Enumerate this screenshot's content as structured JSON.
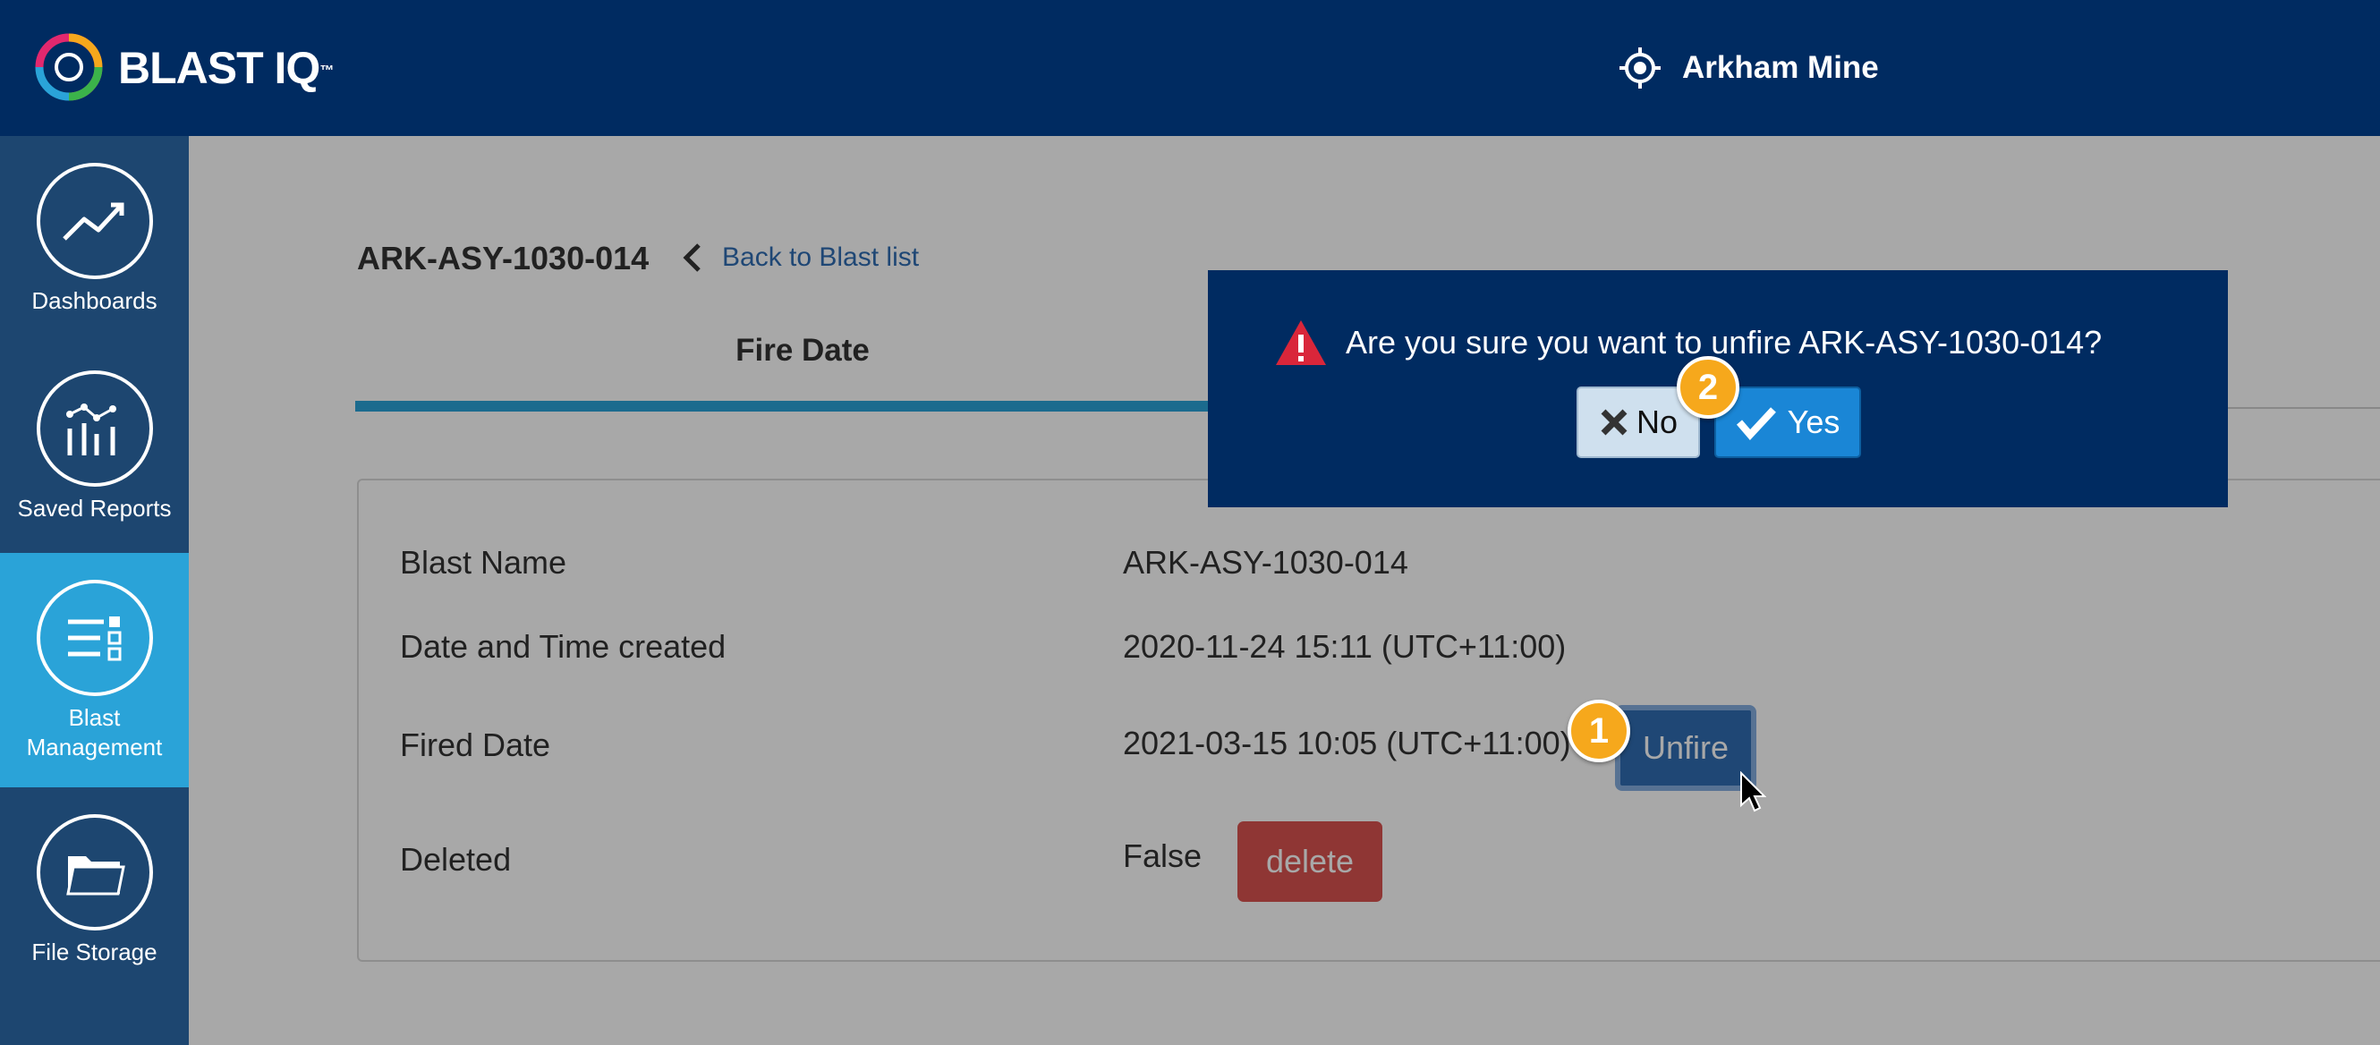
{
  "header": {
    "brand": "BLAST IQ",
    "trademark": "™",
    "site_name": "Arkham Mine",
    "colors": {
      "bar": "#002b61"
    }
  },
  "sidebar": {
    "items": [
      {
        "label": "Dashboards",
        "icon": "trend-chart-icon",
        "active": false
      },
      {
        "label": "Saved Reports",
        "icon": "report-bars-icon",
        "active": false
      },
      {
        "label": "Blast Management",
        "label_line1": "Blast",
        "label_line2": "Management",
        "icon": "list-settings-icon",
        "active": true
      },
      {
        "label": "File Storage",
        "icon": "folder-icon",
        "active": false
      }
    ]
  },
  "main": {
    "blast_title": "ARK-ASY-1030-014",
    "back_link": "Back to Blast list",
    "active_tab": "Fire Date",
    "rows": [
      {
        "label": "Blast Name",
        "value": "ARK-ASY-1030-014"
      },
      {
        "label": "Date and Time created",
        "value": "2020-11-24 15:11 (UTC+11:00)"
      },
      {
        "label": "Fired Date",
        "value": "2021-03-15 10:05 (UTC+11:00)"
      },
      {
        "label": "Deleted",
        "value": "False"
      }
    ],
    "unfire_label": "Unfire",
    "delete_label": "delete"
  },
  "modal": {
    "message": "Are you sure you want to unfire ARK-ASY-1030-014?",
    "no_label": "No",
    "yes_label": "Yes"
  },
  "annotations": {
    "step1": "1",
    "step2": "2",
    "badge_color": "#f6a81c"
  }
}
